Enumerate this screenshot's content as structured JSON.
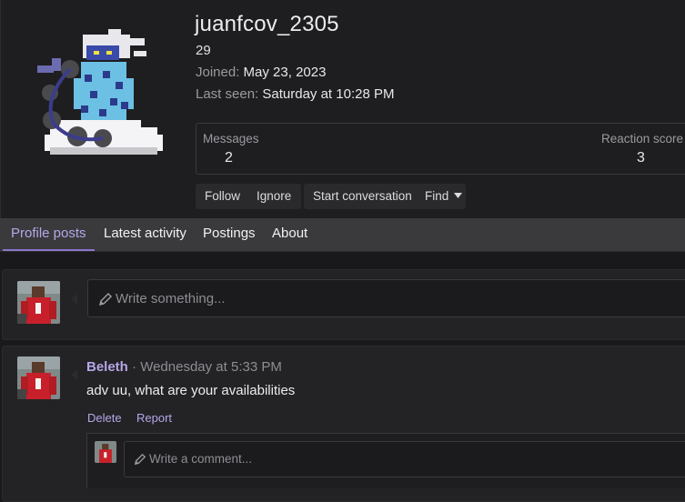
{
  "profile": {
    "username": "juanfcov_2305",
    "user_title": "29",
    "joined_label": "Joined:",
    "joined_value": "May 23, 2023",
    "last_seen_label": "Last seen:",
    "last_seen_value": "Saturday at 10:28 PM"
  },
  "stats": {
    "messages_label": "Messages",
    "messages_value": "2",
    "reaction_label": "Reaction score",
    "reaction_value": "3"
  },
  "actions": {
    "follow": "Follow",
    "ignore": "Ignore",
    "start_conversation": "Start conversation",
    "find": "Find"
  },
  "tabs": [
    "Profile posts",
    "Latest activity",
    "Postings",
    "About"
  ],
  "composer": {
    "placeholder": "Write something..."
  },
  "post": {
    "author": "Beleth",
    "separator": " · ",
    "time": "Wednesday at 5:33 PM",
    "body": "adv uu, what are your availabilities",
    "delete": "Delete",
    "report": "Report",
    "comment_placeholder": "Write a comment..."
  },
  "colors": {
    "accent": "#b6a6e6",
    "background": "#19191b",
    "tab_bar": "#3a3a3d"
  }
}
